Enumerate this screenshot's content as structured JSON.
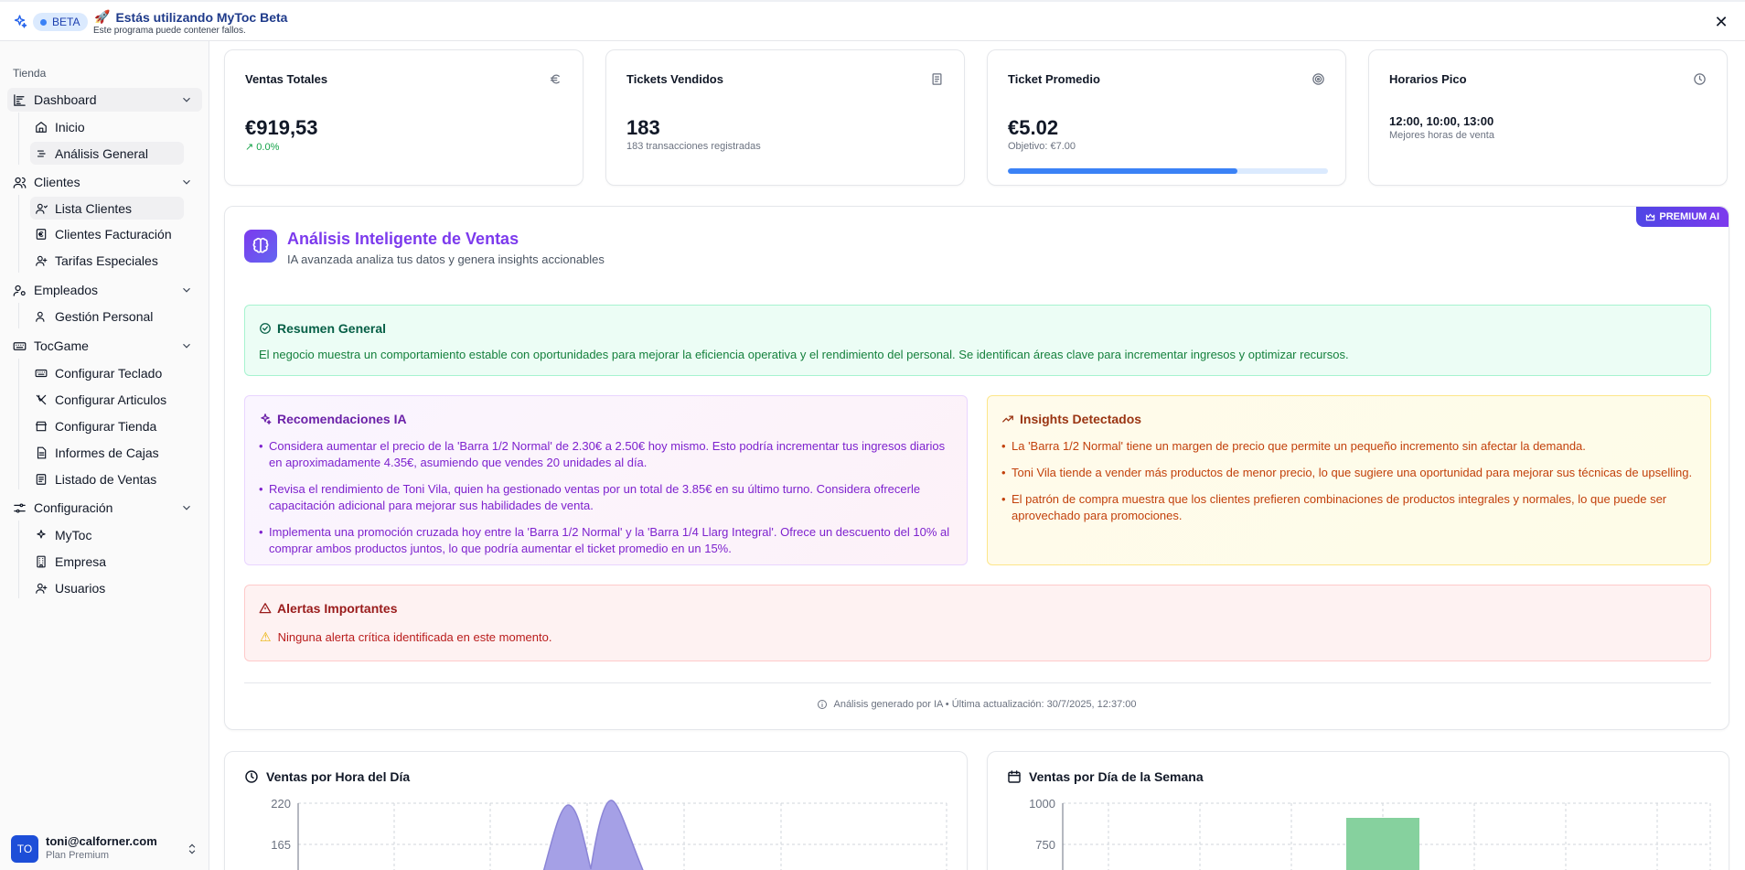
{
  "beta_banner": {
    "badge": "BETA",
    "title": "Estás utilizando MyToc Beta",
    "subtitle": "Este programa puede contener fallos.",
    "rocket_icon": "🚀",
    "close_icon": "✕"
  },
  "sidebar": {
    "section_label": "Tienda",
    "groups": [
      {
        "label": "Dashboard",
        "icon": "dashboard-icon",
        "items": [
          {
            "label": "Inicio",
            "icon": "home-icon"
          },
          {
            "label": "Análisis General",
            "icon": "list-icon",
            "active": true
          }
        ]
      },
      {
        "label": "Clientes",
        "icon": "users-icon",
        "items": [
          {
            "label": "Lista Clientes",
            "icon": "user-icon"
          },
          {
            "label": "Clientes Facturación",
            "icon": "euro-icon"
          },
          {
            "label": "Tarifas Especiales",
            "icon": "user-icon"
          }
        ]
      },
      {
        "label": "Empleados",
        "icon": "employees-icon",
        "items": [
          {
            "label": "Gestión Personal",
            "icon": "users-icon"
          }
        ]
      },
      {
        "label": "TocGame",
        "icon": "keyboard-icon",
        "items": [
          {
            "label": "Configurar Teclado",
            "icon": "keyboard-icon"
          },
          {
            "label": "Configurar Articulos",
            "icon": "utensils-icon"
          },
          {
            "label": "Configurar Tienda",
            "icon": "store-icon"
          },
          {
            "label": "Informes de Cajas",
            "icon": "report-icon"
          },
          {
            "label": "Listado de Ventas",
            "icon": "sales-list-icon"
          }
        ]
      },
      {
        "label": "Configuración",
        "icon": "settings-icon",
        "items": [
          {
            "label": "MyToc",
            "icon": "sparkles-icon"
          },
          {
            "label": "Empresa",
            "icon": "building-icon"
          },
          {
            "label": "Usuarios",
            "icon": "user-icon"
          }
        ]
      }
    ],
    "user": {
      "initials": "TO",
      "email": "toni@calforner.com",
      "plan": "Plan Premium"
    }
  },
  "kpis": [
    {
      "title": "Ventas Totales",
      "icon": "euro-icon",
      "value": "€919,53",
      "sub": "0.0%"
    },
    {
      "title": "Tickets Vendidos",
      "icon": "receipt-icon",
      "value": "183",
      "sub": "183 transacciones registradas"
    },
    {
      "title": "Ticket Promedio",
      "icon": "target-icon",
      "value": "€5.02",
      "sub": "Objetivo: €7.00",
      "progress": 0.717
    },
    {
      "title": "Horarios Pico",
      "icon": "clock-icon",
      "value": "12:00, 10:00, 13:00",
      "sub": "Mejores horas de venta"
    }
  ],
  "ai": {
    "badge": "PREMIUM AI",
    "title": "Análisis Inteligente de Ventas",
    "subtitle": "IA avanzada analiza tus datos y genera insights accionables",
    "summary_title": "Resumen General",
    "summary_text": "El negocio muestra un comportamiento estable con oportunidades para mejorar la eficiencia operativa y el rendimiento del personal. Se identifican áreas clave para incrementar ingresos y optimizar recursos.",
    "recs_title": "Recomendaciones IA",
    "recommendations": [
      "Considera aumentar el precio de la 'Barra 1/2 Normal' de 2.30€ a 2.50€ hoy mismo. Esto podría incrementar tus ingresos diarios en aproximadamente 4.35€, asumiendo que vendes 20 unidades al día.",
      "Revisa el rendimiento de Toni Vila, quien ha gestionado ventas por un total de 3.85€ en su último turno. Considera ofrecerle capacitación adicional para mejorar sus habilidades de venta.",
      "Implementa una promoción cruzada hoy entre la 'Barra 1/2 Normal' y la 'Barra 1/4 Llarg Integral'. Ofrece un descuento del 10% al comprar ambos productos juntos, lo que podría aumentar el ticket promedio en un 15%."
    ],
    "insights_title": "Insights Detectados",
    "insights": [
      "La 'Barra 1/2 Normal' tiene un margen de precio que permite un pequeño incremento sin afectar la demanda.",
      "Toni Vila tiende a vender más productos de menor precio, lo que sugiere una oportunidad para mejorar sus técnicas de upselling.",
      "El patrón de compra muestra que los clientes prefieren combinaciones de productos integrales y normales, lo que puede ser aprovechado para promociones."
    ],
    "alerts_title": "Alertas Importantes",
    "alerts_text": "Ninguna alerta crítica identificada en este momento.",
    "footer": "Análisis generado por IA • Última actualización: 30/7/2025, 12:37:00"
  },
  "chart_data": [
    {
      "type": "area",
      "title": "Ventas por Hora del Día",
      "y_ticks": [
        "220",
        "165"
      ],
      "color": "#a5a0e6",
      "note": "chart partially visible; only top portion of peaks shown"
    },
    {
      "type": "bar",
      "title": "Ventas por Día de la Semana",
      "y_ticks": [
        "1000",
        "750"
      ],
      "color": "#86d19e",
      "note": "chart partially visible; one bar top visible near 920"
    }
  ]
}
